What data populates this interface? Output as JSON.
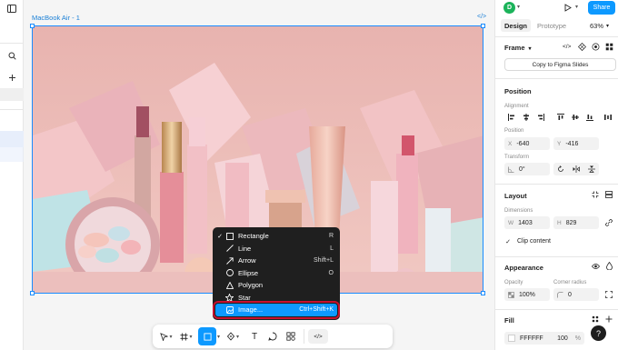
{
  "canvas": {
    "frame_label": "MacBook Air - 1",
    "frame_code_glyph": "</>"
  },
  "menu": {
    "items": [
      {
        "label": "Rectangle",
        "shortcut": "R",
        "checked": true,
        "icon": "rectangle-icon"
      },
      {
        "label": "Line",
        "shortcut": "L",
        "checked": false,
        "icon": "line-icon"
      },
      {
        "label": "Arrow",
        "shortcut": "Shift+L",
        "checked": false,
        "icon": "arrow-icon"
      },
      {
        "label": "Ellipse",
        "shortcut": "O",
        "checked": false,
        "icon": "ellipse-icon"
      },
      {
        "label": "Polygon",
        "shortcut": "",
        "checked": false,
        "icon": "polygon-icon"
      },
      {
        "label": "Star",
        "shortcut": "",
        "checked": false,
        "icon": "star-icon"
      },
      {
        "label": "Image...",
        "shortcut": "Ctrl+Shift+K",
        "checked": false,
        "icon": "image-icon",
        "selected": true
      }
    ],
    "check_glyph": "✓"
  },
  "toolbar": {
    "text_glyph": "T",
    "code_glyph": "</>"
  },
  "right": {
    "avatar_letter": "D",
    "share_label": "Share",
    "tabs": {
      "design": "Design",
      "prototype": "Prototype"
    },
    "zoom": "63%",
    "frame_title": "Frame",
    "copy_to_slides": "Copy to Figma Slides",
    "position": {
      "heading": "Position",
      "alignment_label": "Alignment",
      "position_label": "Position",
      "x_prefix": "X",
      "x_value": "-640",
      "y_prefix": "Y",
      "y_value": "-416",
      "transform_label": "Transform",
      "rotation_value": "0°"
    },
    "layout": {
      "heading": "Layout",
      "dimensions_label": "Dimensions",
      "w_prefix": "W",
      "w_value": "1403",
      "h_prefix": "H",
      "h_value": "829",
      "clip_content": "Clip content"
    },
    "appearance": {
      "heading": "Appearance",
      "opacity_label": "Opacity",
      "opacity_value": "100%",
      "corner_label": "Corner radius",
      "corner_value": "0"
    },
    "fill": {
      "heading": "Fill",
      "hex": "FFFFFF",
      "opacity": "100",
      "percent": "%"
    },
    "help": "?"
  },
  "colors": {
    "accent": "#0d99ff",
    "selection": "#1a8cff",
    "highlight_outline": "#c8102e",
    "menu_bg": "#1f1f1f",
    "avatar": "#1bb35a"
  }
}
